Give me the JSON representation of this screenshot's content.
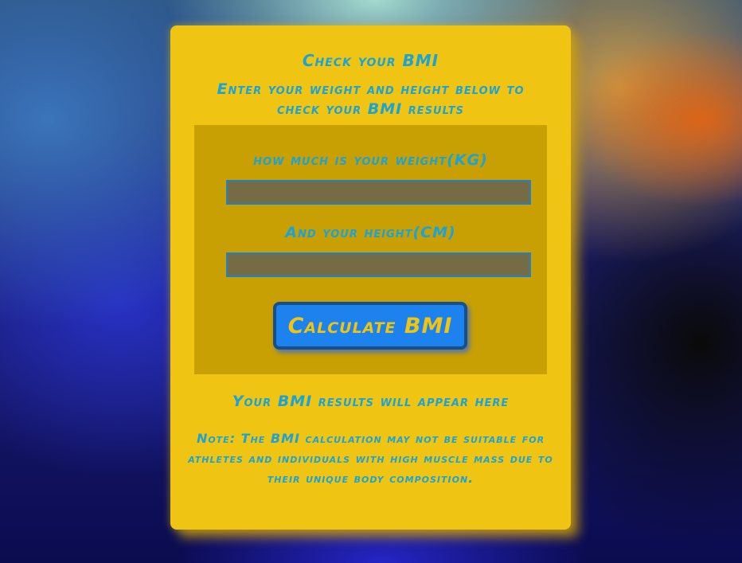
{
  "card": {
    "title": "Check your BMI",
    "subtitle": "Enter your weight and height below to check your BMI results"
  },
  "form": {
    "weight_label": "how much is your weight(KG)",
    "weight_value": "",
    "height_label": "And your height(CM)",
    "height_value": "",
    "calculate_label": "Calculate BMI"
  },
  "results": {
    "placeholder_text": "Your BMI results will appear here"
  },
  "note": {
    "text": "Note: The BMI calculation may not be suitable for athletes and individuals with high muscle mass due to their unique body composition."
  },
  "colors": {
    "card_background": "#f0c412",
    "form_panel_background": "#c8a004",
    "text_accent": "#1aa3d4",
    "button_background": "#1c82ee",
    "button_border": "#184e8a",
    "input_background": "#756c45"
  }
}
